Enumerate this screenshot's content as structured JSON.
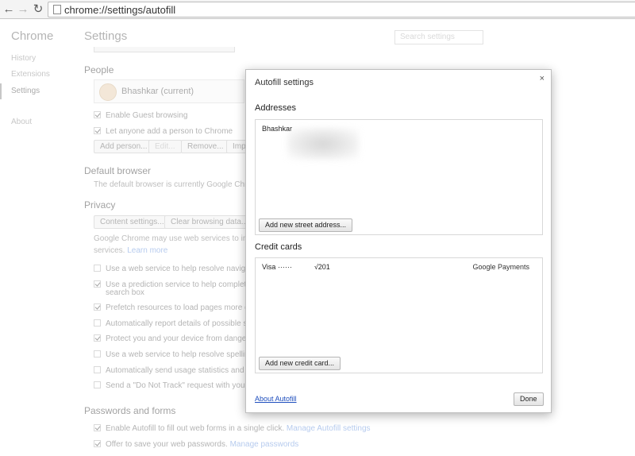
{
  "browser": {
    "back_glyph": "←",
    "forward_glyph": "→",
    "reload_glyph": "↻",
    "url": "chrome://settings/autofill"
  },
  "sidebar": {
    "title": "Chrome",
    "items": [
      {
        "label": "History"
      },
      {
        "label": "Extensions"
      },
      {
        "label": "Settings"
      },
      {
        "label": "About"
      }
    ]
  },
  "settings": {
    "title": "Settings",
    "search_placeholder": "Search settings",
    "people": {
      "heading": "People",
      "current_user": "Bhashkar (current)",
      "enable_guest": "Enable Guest browsing",
      "let_anyone_add": "Let anyone add a person to Chrome",
      "buttons": [
        "Add person...",
        "Edit...",
        "Remove...",
        "Impo"
      ]
    },
    "default_browser": {
      "heading": "Default browser",
      "text": "The default browser is currently Google Chrome."
    },
    "privacy": {
      "heading": "Privacy",
      "buttons": [
        "Content settings...",
        "Clear browsing data..."
      ],
      "text_line1": "Google Chrome may use web services to improve",
      "text_line2": "services.",
      "learn_more": "Learn more",
      "options": [
        {
          "label": "Use a web service to help resolve navigation e",
          "checked": false
        },
        {
          "label": "Use a prediction service to help complete sear",
          "label2": "search box",
          "checked": true
        },
        {
          "label": "Prefetch resources to load pages more quickly",
          "checked": true
        },
        {
          "label": "Automatically report details of possible security",
          "checked": false
        },
        {
          "label": "Protect you and your device from dangerous si",
          "checked": true
        },
        {
          "label": "Use a web service to help resolve spelling erro",
          "checked": false
        },
        {
          "label": "Automatically send usage statistics and crash r",
          "checked": false
        },
        {
          "label": "Send a \"Do Not Track\" request with your brows",
          "checked": false
        }
      ]
    },
    "passwords": {
      "heading": "Passwords and forms",
      "autofill_text": "Enable Autofill to fill out web forms in a single click.",
      "autofill_link": "Manage Autofill settings",
      "passwords_text": "Offer to save your web passwords.",
      "passwords_link": "Manage passwords"
    }
  },
  "dialog": {
    "title": "Autofill settings",
    "close_glyph": "×",
    "addresses": {
      "heading": "Addresses",
      "entries": [
        "Bhashkar"
      ],
      "add_button": "Add new street address..."
    },
    "credit_cards": {
      "heading": "Credit cards",
      "entry_prefix": "Visa ······",
      "entry_suffix": "√201",
      "entry_source": "Google Payments",
      "add_button": "Add new credit card..."
    },
    "about_link": "About Autofill",
    "done_button": "Done"
  }
}
